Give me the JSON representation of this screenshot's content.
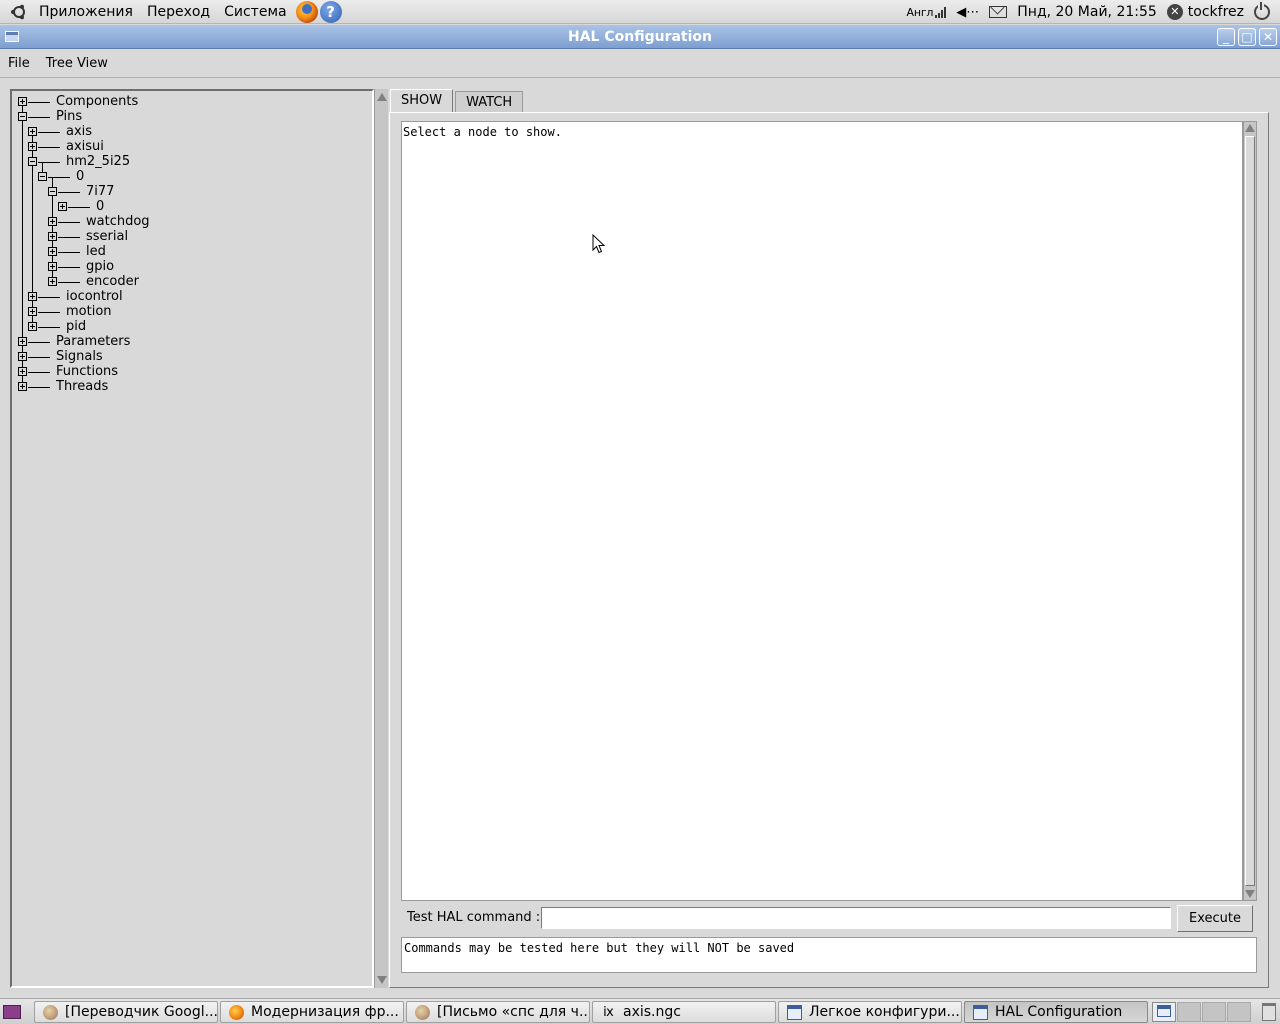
{
  "top_panel": {
    "menus": [
      "Приложения",
      "Переход",
      "Система"
    ],
    "keyboard_layout": "Англ",
    "volume_icon": "speaker-icon",
    "datetime": "Пнд, 20 Май, 21:55",
    "username": "tockfrez"
  },
  "window": {
    "title": "HAL Configuration"
  },
  "menubar": {
    "file": "File",
    "tree_view": "Tree View"
  },
  "tree": {
    "components": "Components",
    "pins": "Pins",
    "axis": "axis",
    "axisui": "axisui",
    "hm2": "hm2_5i25",
    "hm2_0": "0",
    "7i77": "7i77",
    "7i77_0": "0",
    "watchdog": "watchdog",
    "sserial": "sserial",
    "led": "led",
    "gpio": "gpio",
    "encoder": "encoder",
    "iocontrol": "iocontrol",
    "motion": "motion",
    "pid": "pid",
    "parameters": "Parameters",
    "signals": "Signals",
    "functions": "Functions",
    "threads": "Threads"
  },
  "tabs": {
    "show": "SHOW",
    "watch": "WATCH"
  },
  "show_area": {
    "text": "Select a node to show."
  },
  "command": {
    "label": "Test HAL command :",
    "value": "",
    "execute": "Execute",
    "result": "Commands may be tested here but they will NOT be saved"
  },
  "taskbar": {
    "tasks": [
      "[Переводчик Googl...",
      "Модернизация фр...",
      "[Письмо «спс для ч...",
      "axis.ngc",
      "Легкое конфигури...",
      "HAL Configuration"
    ]
  }
}
